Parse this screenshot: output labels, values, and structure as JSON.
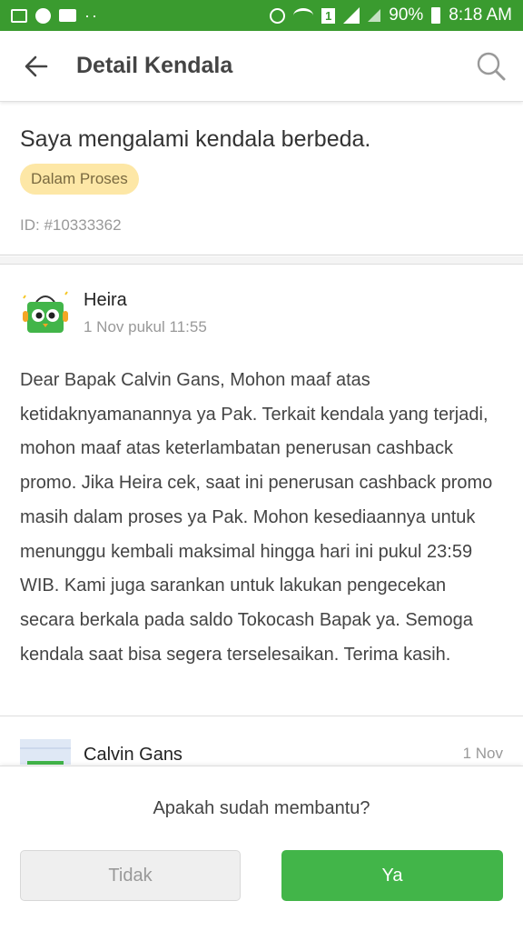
{
  "status_bar": {
    "battery": "90%",
    "time": "8:18 AM",
    "sim_badge": "1",
    "icons": [
      "image-icon",
      "telegram-icon",
      "mail-icon",
      "more-dots-icon",
      "alarm-icon",
      "wifi-icon",
      "signal-icon",
      "battery-icon"
    ]
  },
  "appbar": {
    "title": "Detail Kendala",
    "icons": [
      "back-arrow-icon",
      "search-icon"
    ]
  },
  "ticket": {
    "title": "Saya mengalami kendala berbeda.",
    "status": "Dalam Proses",
    "id": "ID: #10333362"
  },
  "messages": [
    {
      "sender": "Heira",
      "time": "1 Nov pukul 11:55",
      "body": "Dear Bapak Calvin Gans, Mohon maaf atas ketidaknyamanannya ya Pak.  Terkait kendala yang terjadi, mohon maaf atas keterlambatan penerusan cashback promo. Jika Heira cek, saat ini penerusan cashback promo masih dalam proses ya Pak. Mohon kesediaannya untuk menunggu kembali maksimal hingga hari ini pukul 23:59 WIB. Kami juga sarankan untuk lakukan pengecekan secara berkala pada saldo Tokocash Bapak ya. Semoga kendala saat bisa segera terselesaikan. Terima kasih."
    },
    {
      "sender": "Calvin Gans",
      "time": "1 Nov"
    }
  ],
  "footer": {
    "question": "Apakah sudah membantu?",
    "no_label": "Tidak",
    "yes_label": "Ya"
  },
  "colors": {
    "status_bar": "#3a9b2f",
    "accent": "#42b549",
    "badge_bg": "#fde7a6"
  }
}
